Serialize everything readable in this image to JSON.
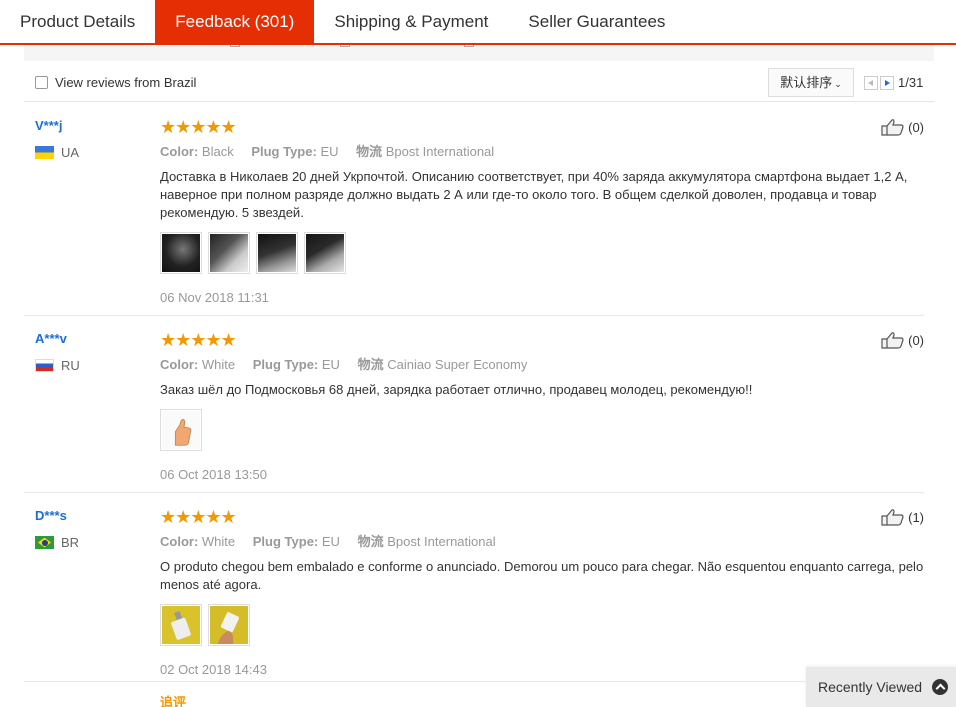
{
  "tabs": [
    {
      "label": "Product Details"
    },
    {
      "label": "Feedback (301)"
    },
    {
      "label": "Shipping & Payment"
    },
    {
      "label": "Seller Guarantees"
    }
  ],
  "filters": {
    "country_filter_label": "View reviews from Brazil",
    "sort_label": "默认排序",
    "page": "1/31"
  },
  "reviews": [
    {
      "user": "V***j",
      "country": "UA",
      "rating": 5,
      "color_label": "Color:",
      "color_value": "Black",
      "plug_label": "Plug Type:",
      "plug_value": "EU",
      "shipping_label": "物流",
      "shipping_value": "Bpost International",
      "text": "Доставка в Николаев 20 дней Укрпочтой. Описанию соответствует, при 40% заряда аккумулятора смартфона выдает 1,2 А, наверное при полном разряде должно выдать 2 А или где-то около того. В общем сделкой доволен, продавца и товар рекомендую. 5 звездей.",
      "date": "06 Nov 2018 11:31",
      "helpful": "(0)"
    },
    {
      "user": "A***v",
      "country": "RU",
      "rating": 5,
      "color_label": "Color:",
      "color_value": "White",
      "plug_label": "Plug Type:",
      "plug_value": "EU",
      "shipping_label": "物流",
      "shipping_value": "Cainiao Super Economy",
      "text": "Заказ шёл до Подмосковья 68 дней, зарядка работает отлично, продавец молодец, рекомендую!!",
      "date": "06 Oct 2018 13:50",
      "helpful": "(0)"
    },
    {
      "user": "D***s",
      "country": "BR",
      "rating": 5,
      "color_label": "Color:",
      "color_value": "White",
      "plug_label": "Plug Type:",
      "plug_value": "EU",
      "shipping_label": "物流",
      "shipping_value": "Bpost International",
      "text": "O produto chegou bem embalado e conforme o anunciado. Demorou um pouco para chegar. Não esquentou enquanto carrega, pelo menos até agora.",
      "date": "02 Oct 2018 14:43",
      "helpful": "(1)",
      "followup_label": "追评"
    }
  ],
  "stars_glyph": "★★★★★",
  "recently_viewed": "Recently Viewed",
  "colors": {
    "accent": "#e62e04",
    "link": "#1c6ed5",
    "star": "#f39800",
    "muted": "#999999"
  },
  "icons": [
    "thumbs-up-icon",
    "chevron-up-icon",
    "chevron-down-icon",
    "arrow-left-icon",
    "arrow-right-icon",
    "flag-icon"
  ]
}
